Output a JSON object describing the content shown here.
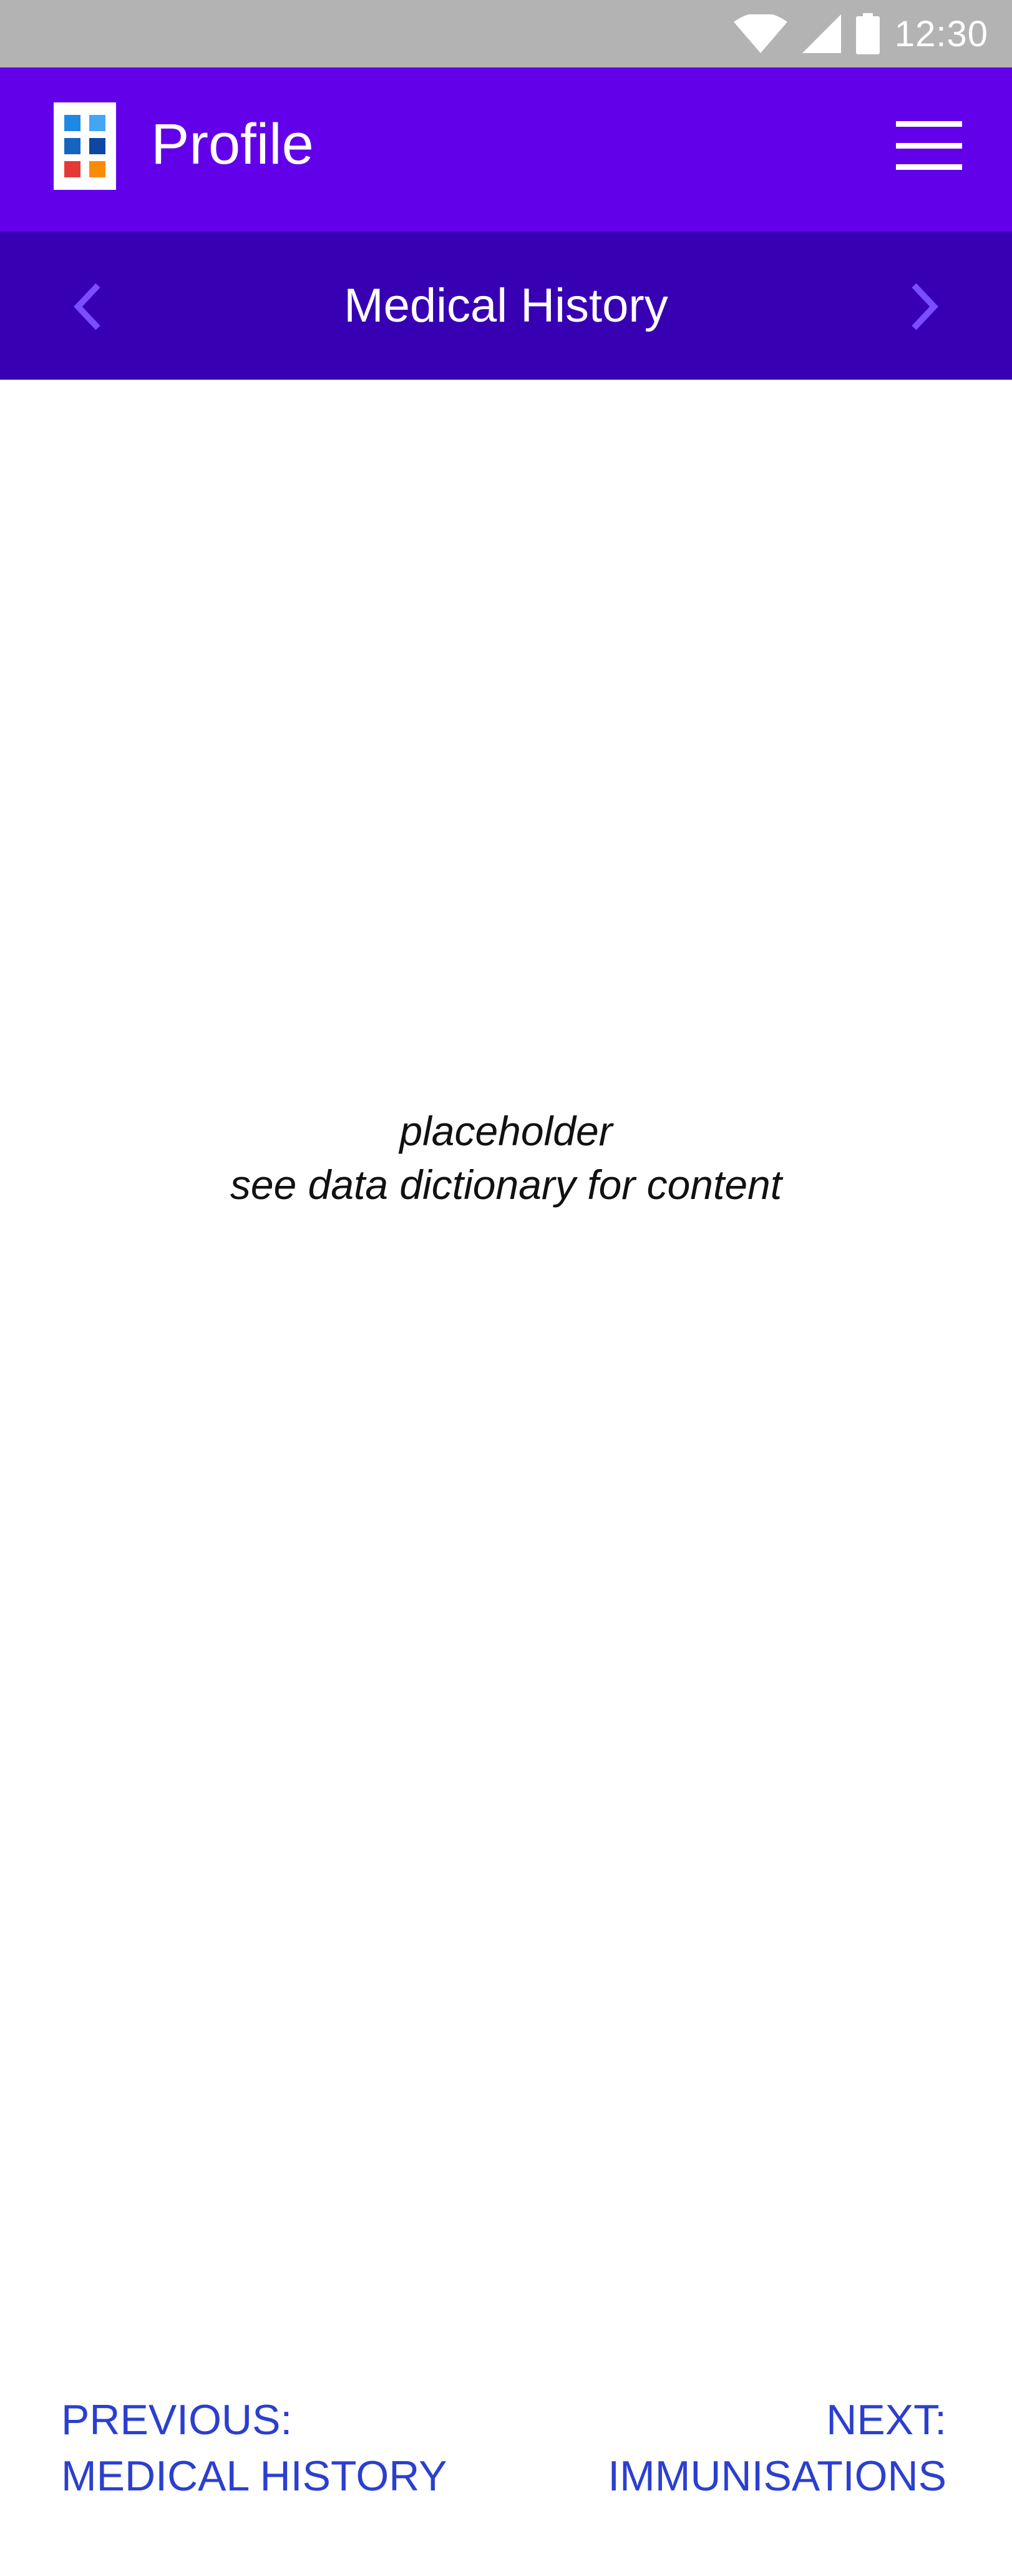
{
  "status_bar": {
    "time": "12:30",
    "icons": [
      "wifi-icon",
      "signal-icon",
      "battery-icon"
    ]
  },
  "app_bar": {
    "title": "Profile",
    "logo_colors": [
      "#1e88e5",
      "#1565c0",
      "#0d47a1",
      "#26a69a",
      "#e53935",
      "#fb8c00"
    ],
    "menu_icon": "hamburger-menu-icon"
  },
  "section_nav": {
    "title": "Medical History",
    "prev_icon": "chevron-left-icon",
    "next_icon": "chevron-right-icon"
  },
  "content": {
    "placeholder_line1": "placeholder",
    "placeholder_line2": "see data dictionary for content"
  },
  "footer": {
    "previous_label": "PREVIOUS:",
    "previous_target": "MEDICAL HISTORY",
    "next_label": "NEXT:",
    "next_target": "IMMUNISATIONS"
  },
  "colors": {
    "app_bar": "#6200ea",
    "section_bar": "#3700b3",
    "status_bar": "#b3b3b3",
    "link": "#2b3fcf"
  }
}
